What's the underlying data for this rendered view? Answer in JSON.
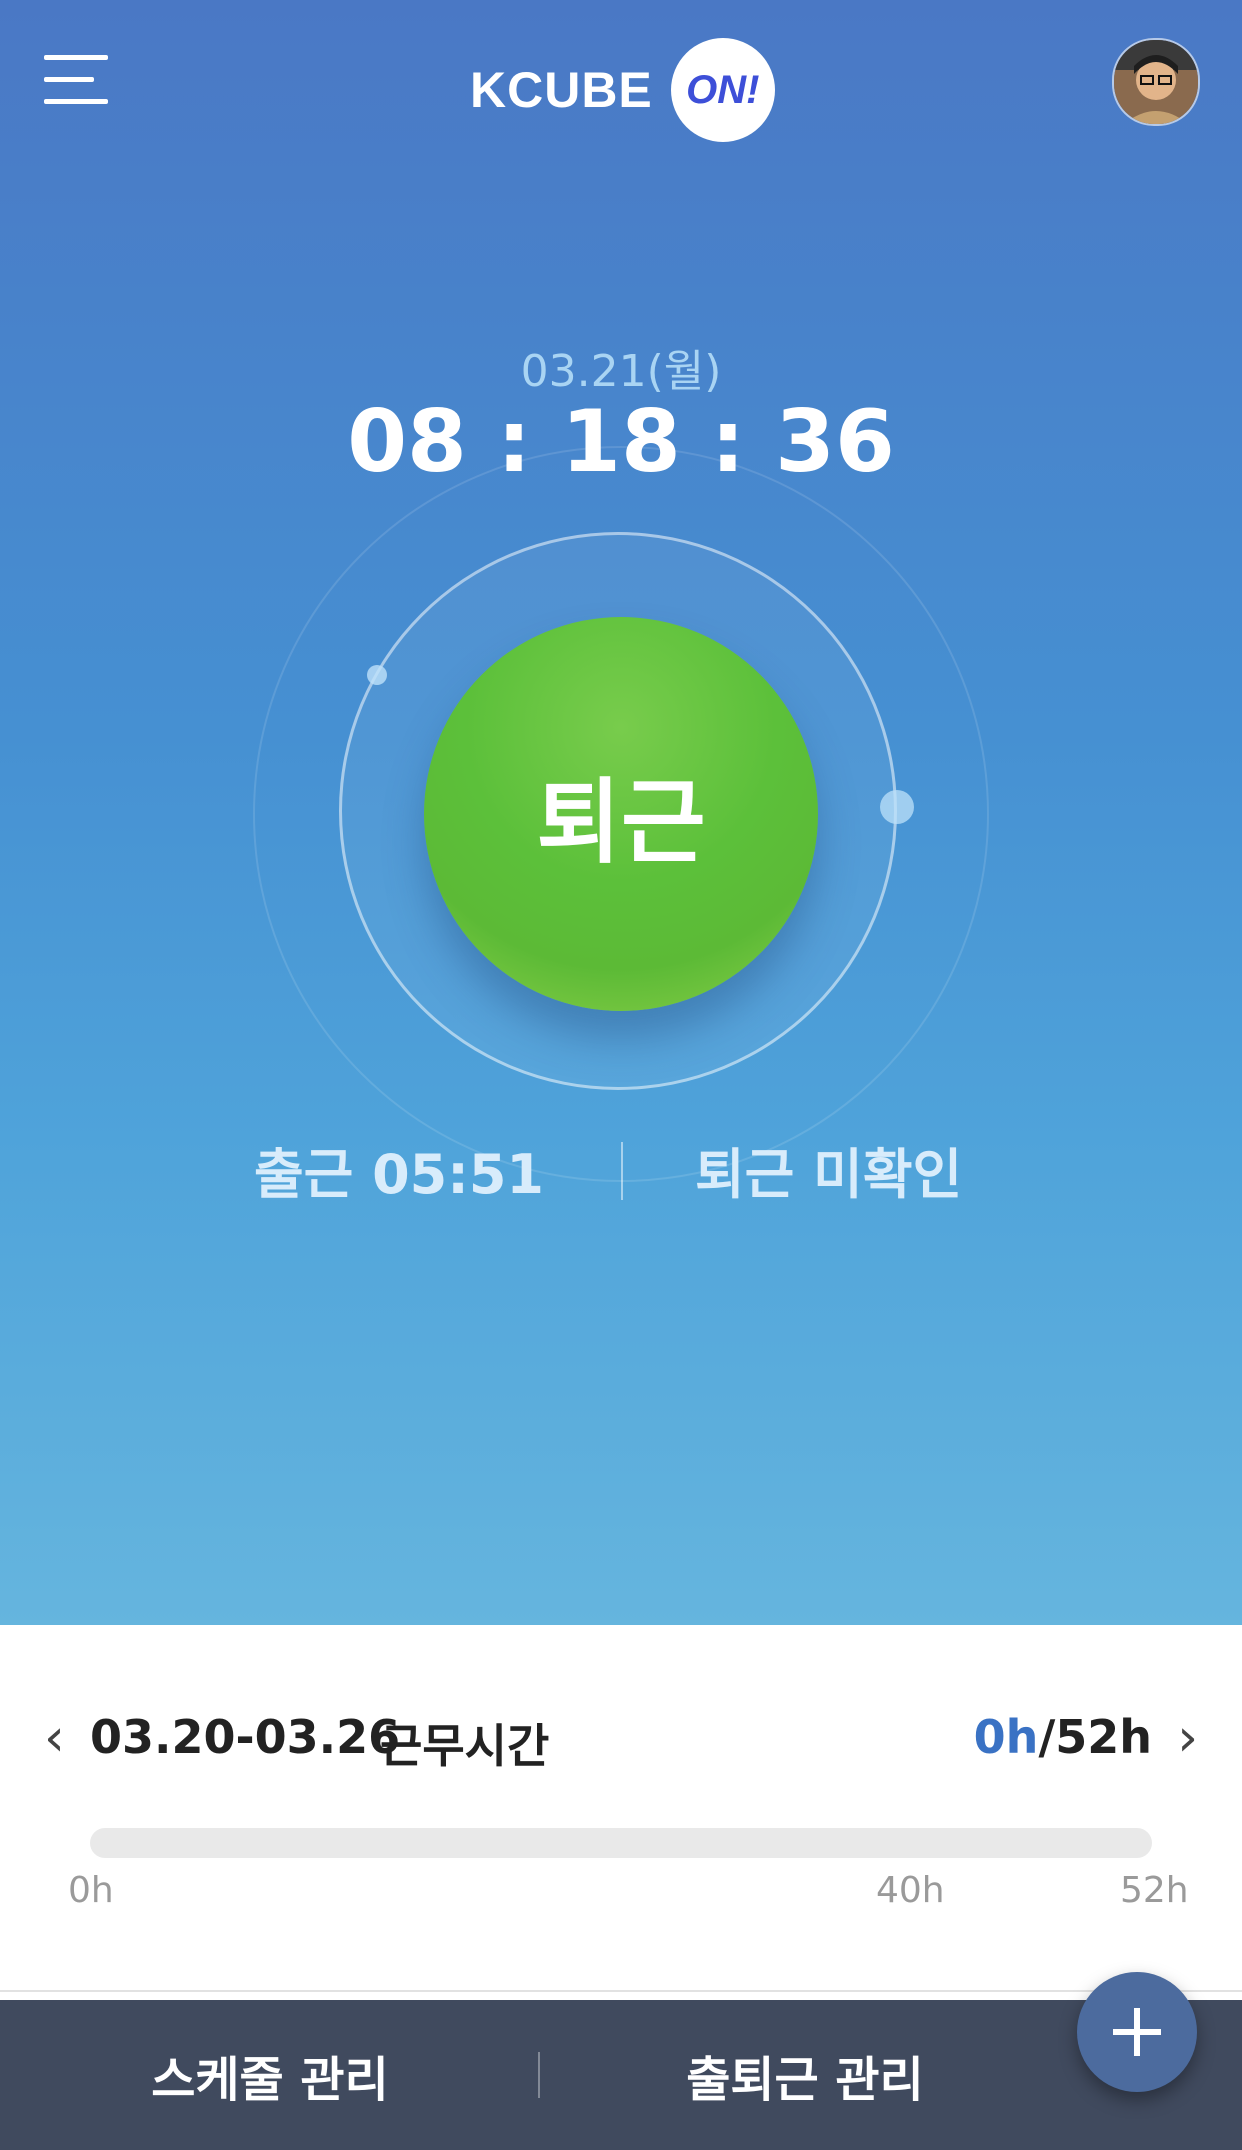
{
  "header": {
    "logo_text": "KCUBE",
    "logo_badge": "ON!",
    "menu_icon": "hamburger-icon",
    "avatar_icon": "user-avatar"
  },
  "status": {
    "date": "03.21(월)",
    "time": "08 : 18 : 36",
    "main_button_label": "퇴근",
    "check_in": "출근 05:51",
    "check_out": "퇴근 미확인"
  },
  "work_week": {
    "range": "03.20-03.26",
    "label": "근무시간",
    "current_hours": "0h",
    "total_hours": "/52h",
    "progress_fraction": 0,
    "ticks": [
      "0h",
      "40h",
      "52h"
    ]
  },
  "bottom_nav": {
    "schedule_label": "스케줄 관리",
    "attendance_label": "출퇴근 관리",
    "fab_icon": "plus-icon"
  },
  "colors": {
    "hero_top": "#4a78c5",
    "hero_bottom": "#65b5de",
    "button_green": "#5cc03a",
    "accent_blue": "#3a72c4",
    "nav_bg": "#404a5e"
  }
}
